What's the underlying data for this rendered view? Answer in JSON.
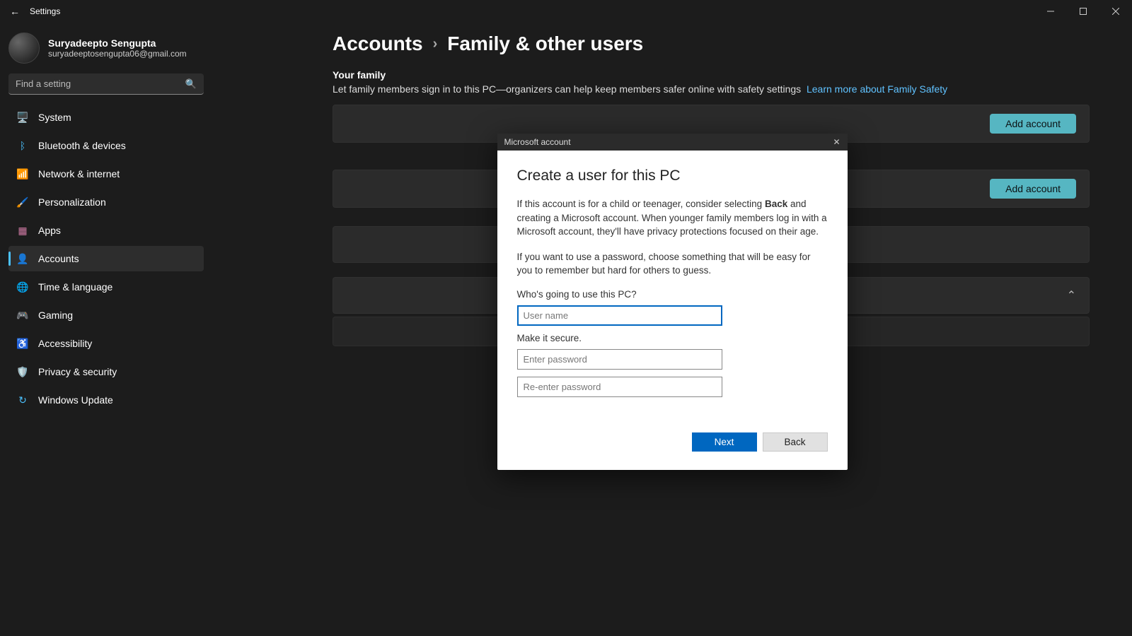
{
  "window": {
    "title": "Settings"
  },
  "profile": {
    "name": "Suryadeepto Sengupta",
    "email": "suryadeeptosengupta06@gmail.com"
  },
  "search": {
    "placeholder": "Find a setting"
  },
  "sidebar": {
    "items": [
      {
        "label": "System"
      },
      {
        "label": "Bluetooth & devices"
      },
      {
        "label": "Network & internet"
      },
      {
        "label": "Personalization"
      },
      {
        "label": "Apps"
      },
      {
        "label": "Accounts"
      },
      {
        "label": "Time & language"
      },
      {
        "label": "Gaming"
      },
      {
        "label": "Accessibility"
      },
      {
        "label": "Privacy & security"
      },
      {
        "label": "Windows Update"
      }
    ]
  },
  "breadcrumb": {
    "parent": "Accounts",
    "current": "Family & other users"
  },
  "family": {
    "heading": "Your family",
    "description": "Let family members sign in to this PC—organizers can help keep members safer online with safety settings",
    "link": "Learn more about Family Safety",
    "addButton": "Add account"
  },
  "other": {
    "addButton": "Add account"
  },
  "dialog": {
    "title": "Microsoft account",
    "heading": "Create a user for this PC",
    "p1_pre": "If this account is for a child or teenager, consider selecting ",
    "p1_bold": "Back",
    "p1_post": " and creating a Microsoft account. When younger family members log in with a Microsoft account, they'll have privacy protections focused on their age.",
    "p2": "If you want to use a password, choose something that will be easy for you to remember but hard for others to guess.",
    "whoLabel": "Who's going to use this PC?",
    "usernamePlaceholder": "User name",
    "secureLabel": "Make it secure.",
    "pw1Placeholder": "Enter password",
    "pw2Placeholder": "Re-enter password",
    "next": "Next",
    "back": "Back"
  }
}
